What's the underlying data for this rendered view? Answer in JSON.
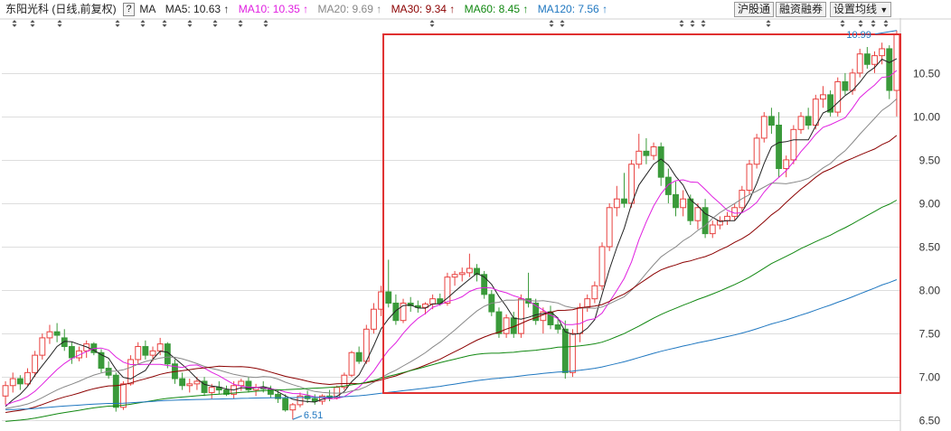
{
  "header": {
    "title": "东阳光科 (日线,前复权)",
    "help": "?",
    "ma_label": "MA",
    "ma_items": [
      {
        "label": "MA5: 10.63",
        "arrow": "↑",
        "color": "#222222"
      },
      {
        "label": "MA10: 10.35",
        "arrow": "↑",
        "color": "#e020e0"
      },
      {
        "label": "MA20: 9.69",
        "arrow": "↑",
        "color": "#888888"
      },
      {
        "label": "MA30: 9.34",
        "arrow": "↑",
        "color": "#8b0000"
      },
      {
        "label": "MA60: 8.45",
        "arrow": "↑",
        "color": "#118811"
      },
      {
        "label": "MA120: 7.56",
        "arrow": "↑",
        "color": "#1f77c0"
      }
    ],
    "buttons": [
      "沪股通",
      "融资融券",
      "设置均线"
    ],
    "dropdown_arrow": "▼"
  },
  "colors": {
    "up": "#e8413f",
    "down": "#3a9a3a",
    "highlight_box": "#e03030",
    "grid": "#dddddd"
  },
  "chart_data": {
    "type": "candlestick",
    "title": "东阳光科 (日线,前复权)",
    "y_ticks": [
      "10.50",
      "10.00",
      "9.50",
      "9.00",
      "8.50",
      "8.00",
      "7.50",
      "7.00",
      "6.50"
    ],
    "ylim": [
      6.45,
      11.05
    ],
    "grid": true,
    "annotations": [
      {
        "text": "10.99",
        "kind": "high",
        "value": 10.99
      },
      {
        "text": "6.51",
        "kind": "low",
        "value": 6.51
      }
    ],
    "highlight_range": {
      "from_index": 52,
      "to_index": 130
    },
    "candles": [
      [
        6.78,
        6.95,
        6.68,
        6.9
      ],
      [
        6.9,
        7.05,
        6.82,
        6.98
      ],
      [
        6.98,
        7.02,
        6.85,
        6.92
      ],
      [
        6.92,
        7.1,
        6.9,
        7.05
      ],
      [
        7.05,
        7.3,
        7.0,
        7.25
      ],
      [
        7.25,
        7.5,
        7.2,
        7.45
      ],
      [
        7.45,
        7.6,
        7.38,
        7.52
      ],
      [
        7.52,
        7.62,
        7.4,
        7.48
      ],
      [
        7.45,
        7.55,
        7.3,
        7.35
      ],
      [
        7.35,
        7.4,
        7.15,
        7.22
      ],
      [
        7.22,
        7.35,
        7.18,
        7.3
      ],
      [
        7.3,
        7.42,
        7.22,
        7.38
      ],
      [
        7.38,
        7.4,
        7.25,
        7.28
      ],
      [
        7.28,
        7.32,
        7.05,
        7.1
      ],
      [
        7.1,
        7.18,
        6.98,
        7.02
      ],
      [
        7.02,
        7.05,
        6.6,
        6.65
      ],
      [
        6.65,
        6.95,
        6.62,
        6.92
      ],
      [
        6.92,
        7.25,
        6.9,
        7.2
      ],
      [
        7.2,
        7.4,
        7.15,
        7.35
      ],
      [
        7.35,
        7.42,
        7.2,
        7.25
      ],
      [
        7.25,
        7.35,
        7.18,
        7.3
      ],
      [
        7.3,
        7.45,
        7.25,
        7.38
      ],
      [
        7.38,
        7.4,
        7.1,
        7.15
      ],
      [
        7.15,
        7.2,
        6.92,
        6.98
      ],
      [
        6.98,
        7.05,
        6.85,
        6.9
      ],
      [
        6.9,
        6.98,
        6.82,
        6.92
      ],
      [
        6.92,
        7.0,
        6.85,
        6.95
      ],
      [
        6.95,
        7.0,
        6.78,
        6.82
      ],
      [
        6.82,
        6.92,
        6.75,
        6.88
      ],
      [
        6.88,
        6.95,
        6.8,
        6.85
      ],
      [
        6.85,
        6.9,
        6.78,
        6.8
      ],
      [
        6.8,
        6.95,
        6.75,
        6.9
      ],
      [
        6.9,
        6.98,
        6.84,
        6.95
      ],
      [
        6.95,
        7.0,
        6.82,
        6.85
      ],
      [
        6.85,
        6.92,
        6.78,
        6.88
      ],
      [
        6.88,
        6.95,
        6.82,
        6.86
      ],
      [
        6.86,
        6.9,
        6.76,
        6.8
      ],
      [
        6.8,
        6.85,
        6.7,
        6.75
      ],
      [
        6.75,
        6.8,
        6.6,
        6.62
      ],
      [
        6.62,
        6.7,
        6.51,
        6.68
      ],
      [
        6.68,
        6.82,
        6.65,
        6.78
      ],
      [
        6.78,
        6.84,
        6.7,
        6.75
      ],
      [
        6.75,
        6.8,
        6.68,
        6.72
      ],
      [
        6.72,
        6.8,
        6.68,
        6.78
      ],
      [
        6.78,
        6.85,
        6.72,
        6.76
      ],
      [
        6.76,
        6.9,
        6.74,
        6.88
      ],
      [
        6.88,
        7.05,
        6.85,
        7.02
      ],
      [
        7.02,
        7.3,
        7.0,
        7.28
      ],
      [
        7.28,
        7.35,
        7.15,
        7.18
      ],
      [
        7.18,
        7.6,
        7.15,
        7.55
      ],
      [
        7.55,
        7.85,
        7.5,
        7.78
      ],
      [
        7.78,
        8.05,
        7.7,
        7.98
      ],
      [
        7.98,
        8.35,
        7.8,
        7.85
      ],
      [
        7.85,
        7.95,
        7.6,
        7.65
      ],
      [
        7.65,
        7.9,
        7.62,
        7.85
      ],
      [
        7.85,
        7.92,
        7.75,
        7.82
      ],
      [
        7.82,
        7.88,
        7.74,
        7.8
      ],
      [
        7.8,
        7.86,
        7.72,
        7.84
      ],
      [
        7.84,
        7.95,
        7.78,
        7.9
      ],
      [
        7.9,
        7.96,
        7.82,
        7.85
      ],
      [
        7.85,
        8.2,
        7.82,
        8.15
      ],
      [
        8.15,
        8.22,
        8.05,
        8.18
      ],
      [
        8.18,
        8.26,
        8.1,
        8.2
      ],
      [
        8.2,
        8.42,
        8.15,
        8.25
      ],
      [
        8.25,
        8.3,
        8.1,
        8.18
      ],
      [
        8.18,
        8.22,
        7.9,
        7.95
      ],
      [
        7.95,
        8.0,
        7.7,
        7.75
      ],
      [
        7.75,
        7.8,
        7.45,
        7.5
      ],
      [
        7.5,
        7.72,
        7.45,
        7.68
      ],
      [
        7.68,
        7.75,
        7.45,
        7.5
      ],
      [
        7.5,
        7.95,
        7.45,
        7.9
      ],
      [
        7.9,
        8.2,
        7.8,
        7.85
      ],
      [
        7.85,
        7.9,
        7.6,
        7.65
      ],
      [
        7.65,
        7.8,
        7.5,
        7.75
      ],
      [
        7.75,
        7.82,
        7.55,
        7.6
      ],
      [
        7.6,
        7.68,
        7.5,
        7.55
      ],
      [
        7.55,
        7.65,
        6.98,
        7.05
      ],
      [
        7.05,
        7.55,
        7.0,
        7.5
      ],
      [
        7.5,
        7.85,
        7.4,
        7.8
      ],
      [
        7.8,
        7.95,
        7.75,
        7.9
      ],
      [
        7.9,
        8.1,
        7.85,
        8.05
      ],
      [
        8.05,
        8.55,
        8.0,
        8.5
      ],
      [
        8.5,
        9.0,
        8.45,
        8.95
      ],
      [
        8.95,
        9.2,
        8.85,
        9.05
      ],
      [
        9.05,
        9.35,
        8.95,
        9.0
      ],
      [
        9.0,
        9.5,
        8.95,
        9.45
      ],
      [
        9.45,
        9.8,
        9.4,
        9.6
      ],
      [
        9.6,
        9.75,
        9.45,
        9.55
      ],
      [
        9.55,
        9.7,
        9.5,
        9.65
      ],
      [
        9.65,
        9.7,
        9.2,
        9.3
      ],
      [
        9.3,
        9.4,
        9.0,
        9.1
      ],
      [
        9.1,
        9.25,
        8.85,
        8.95
      ],
      [
        8.95,
        9.15,
        8.85,
        9.05
      ],
      [
        9.05,
        9.1,
        8.75,
        8.8
      ],
      [
        8.8,
        9.0,
        8.7,
        8.95
      ],
      [
        8.95,
        9.05,
        8.6,
        8.65
      ],
      [
        8.65,
        8.8,
        8.6,
        8.75
      ],
      [
        8.75,
        8.85,
        8.7,
        8.8
      ],
      [
        8.8,
        8.9,
        8.75,
        8.85
      ],
      [
        8.85,
        9.0,
        8.8,
        8.95
      ],
      [
        8.95,
        9.2,
        8.9,
        9.15
      ],
      [
        9.15,
        9.5,
        9.1,
        9.45
      ],
      [
        9.45,
        9.8,
        9.4,
        9.75
      ],
      [
        9.75,
        10.05,
        9.7,
        10.0
      ],
      [
        10.0,
        10.1,
        9.8,
        9.9
      ],
      [
        9.9,
        10.05,
        9.3,
        9.4
      ],
      [
        9.4,
        9.55,
        9.3,
        9.5
      ],
      [
        9.5,
        9.9,
        9.45,
        9.85
      ],
      [
        9.85,
        10.05,
        9.8,
        10.0
      ],
      [
        10.0,
        10.1,
        9.85,
        9.9
      ],
      [
        9.9,
        10.25,
        9.85,
        10.2
      ],
      [
        10.2,
        10.35,
        10.1,
        10.25
      ],
      [
        10.25,
        10.3,
        10.0,
        10.05
      ],
      [
        10.05,
        10.45,
        10.0,
        10.4
      ],
      [
        10.4,
        10.5,
        10.25,
        10.3
      ],
      [
        10.3,
        10.55,
        10.25,
        10.5
      ],
      [
        10.5,
        10.78,
        10.45,
        10.72
      ],
      [
        10.72,
        10.8,
        10.55,
        10.6
      ],
      [
        10.6,
        10.75,
        10.5,
        10.7
      ],
      [
        10.7,
        10.85,
        10.6,
        10.78
      ],
      [
        10.78,
        10.82,
        10.2,
        10.3
      ],
      [
        10.3,
        10.99,
        10.0,
        10.95
      ]
    ]
  }
}
